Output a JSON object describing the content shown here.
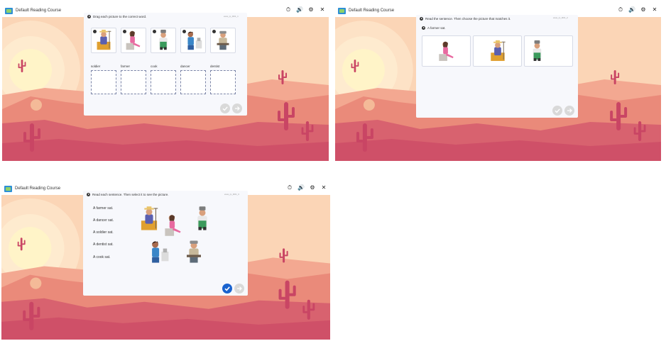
{
  "window": {
    "course_title": "Default Reading Course"
  },
  "colors": {
    "sky": "#fbd5b6",
    "sun": "#fff4c8",
    "far_hills": "#f3a891",
    "mid_hills": "#ea8a7a",
    "near_hills": "#d8626f",
    "cactus": "#c94564",
    "panel": "#f7f8fc",
    "primary": "#1a63cf",
    "disabled": "#d9d9d9"
  },
  "icons": [
    "timer-icon",
    "volume-icon",
    "settings-gear-icon",
    "close-icon",
    "speaker-icon",
    "check-icon",
    "next-arrow-icon"
  ],
  "screen1": {
    "instruction": "Drag each picture to the correct word.",
    "meta": "eww_rp_R01_1",
    "pictures": [
      "farmer",
      "dancer",
      "cook",
      "dentist",
      "soldier"
    ],
    "words": [
      "soldier",
      "farmer",
      "cook",
      "dancer",
      "dentist"
    ]
  },
  "screen2": {
    "instruction": "Read the sentence. Then choose the picture that matches it.",
    "meta": "eww_rp_R01_2",
    "sentence": "A farmer sat.",
    "choices": [
      "dancer",
      "farmer",
      "cook"
    ]
  },
  "screen3": {
    "instruction": "Read each sentence. Then select it to see the picture.",
    "meta": "eww_rp_R01_3",
    "sentences": [
      "A farmer sat.",
      "A dancer sat.",
      "A soldier sat.",
      "A dentist sat.",
      "A cook sat."
    ],
    "pictures": [
      "farmer",
      "dancer",
      "cook",
      "dentist",
      "soldier"
    ]
  }
}
